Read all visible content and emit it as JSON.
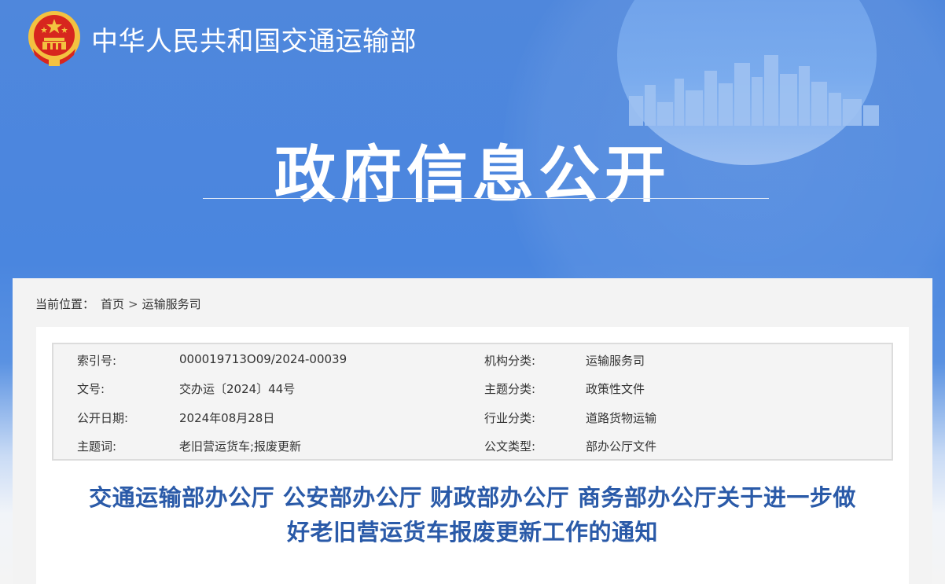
{
  "site": {
    "title": "中华人民共和国交通运输部"
  },
  "hero": {
    "title": "政府信息公开"
  },
  "breadcrumb": {
    "prefix": "当前位置：",
    "home": "首页",
    "separator": ">",
    "current": "运输服务司"
  },
  "meta": [
    {
      "label": "索引号:",
      "value": "000019713O09/2024-00039",
      "label2": "机构分类:",
      "value2": "运输服务司"
    },
    {
      "label": "文号:",
      "value": "交办运〔2024〕44号",
      "label2": "主题分类:",
      "value2": "政策性文件"
    },
    {
      "label": "公开日期:",
      "value": "2024年08月28日",
      "label2": "行业分类:",
      "value2": "道路货物运输"
    },
    {
      "label": "主题词:",
      "value": "老旧营运货车;报废更新",
      "label2": "公文类型:",
      "value2": "部办公厅文件"
    }
  ],
  "document": {
    "title_line1": "交通运输部办公厅 公安部办公厅 财政部办公厅 商务部办公厅关于进一步做",
    "title_line2": "好老旧营运货车报废更新工作的通知"
  },
  "colors": {
    "banner": "#4a86df",
    "title": "#2a5aa8",
    "emblem_red": "#d7261e",
    "emblem_gold": "#f3c240"
  },
  "icons": {
    "emblem": "national-emblem-icon",
    "skyline": "city-skyline-illustration"
  }
}
